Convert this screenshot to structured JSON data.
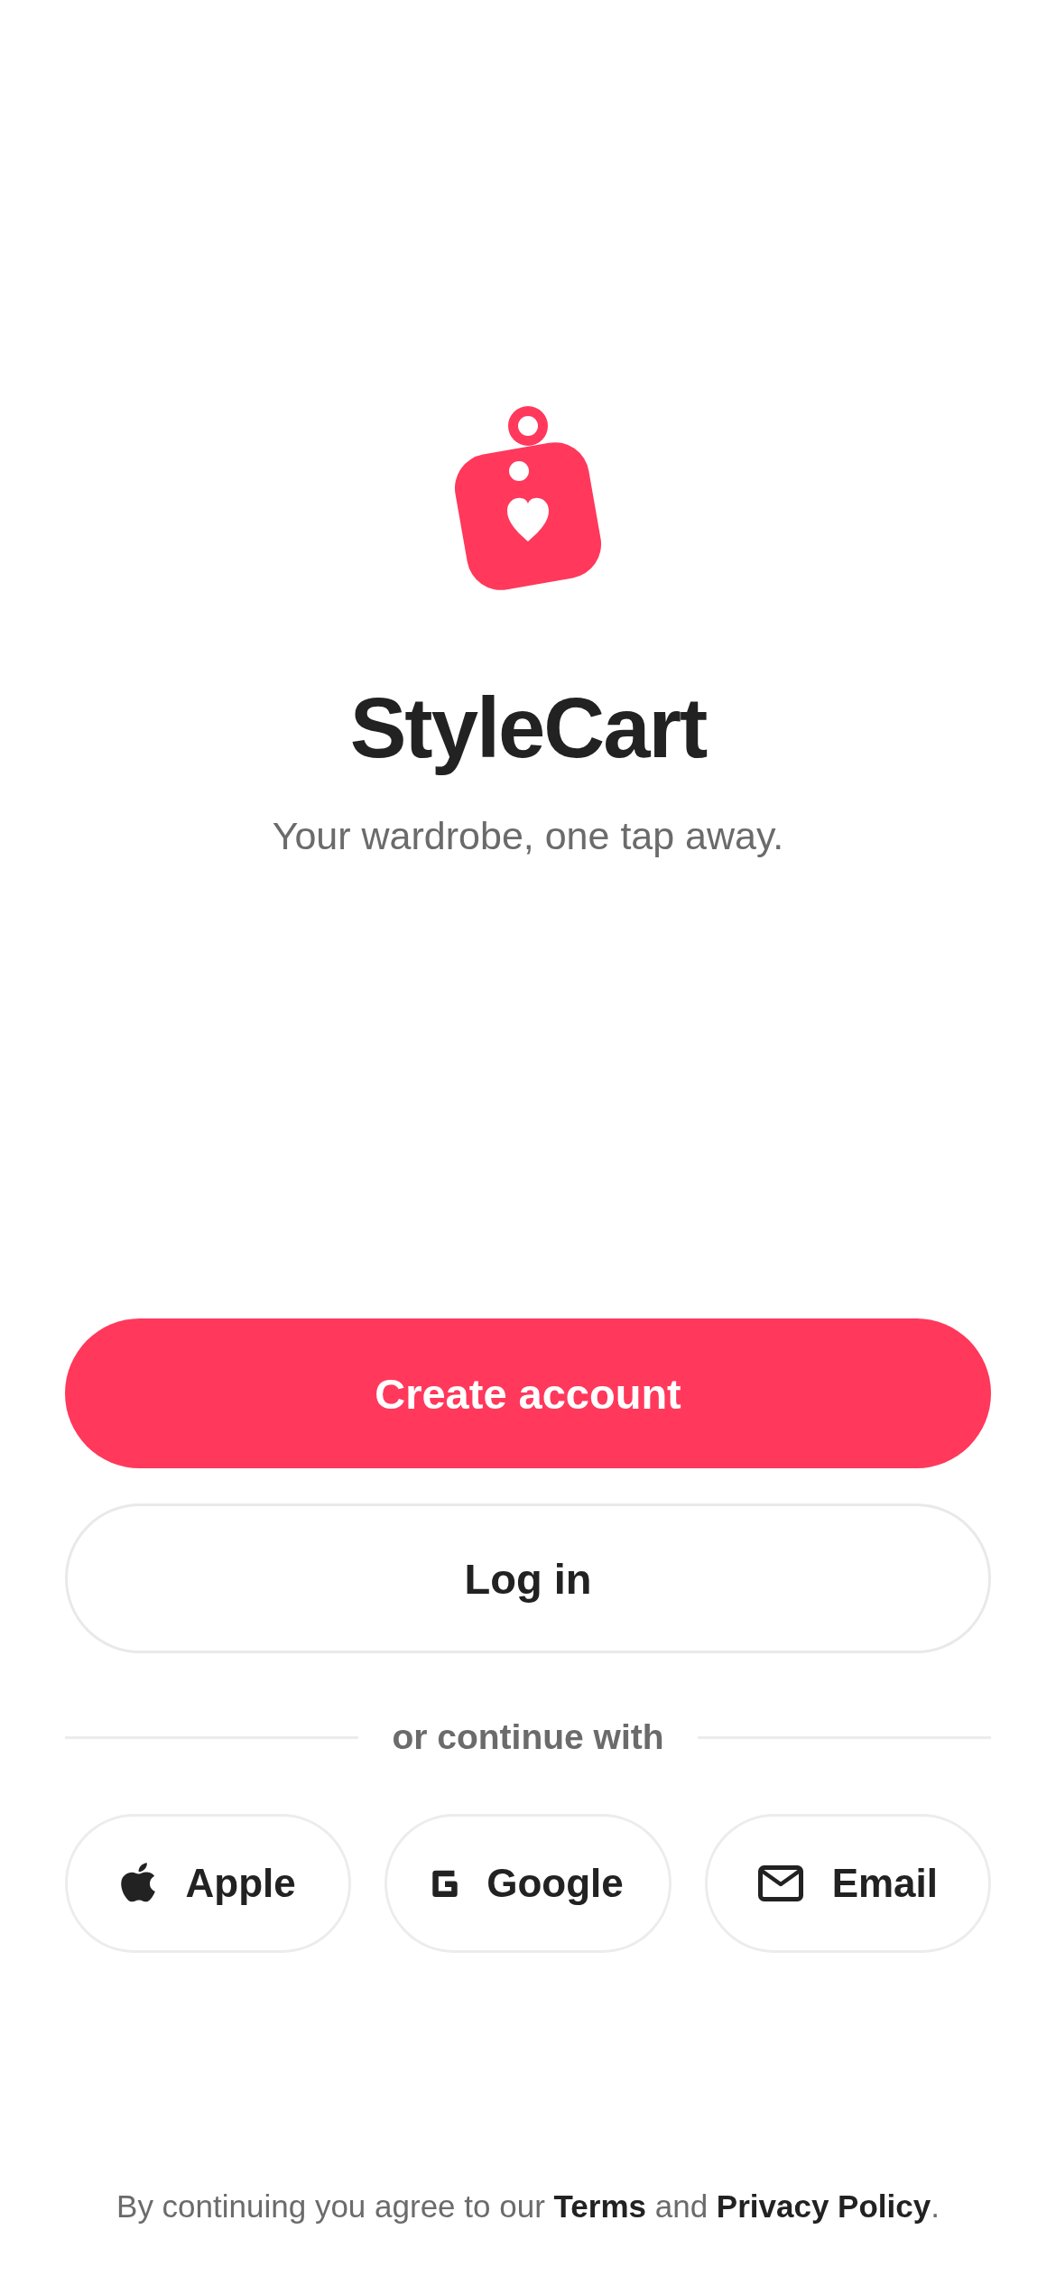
{
  "brand": {
    "name": "StyleCart",
    "tagline": "Your wardrobe, one tap away."
  },
  "actions": [
    {
      "label": "Create account",
      "kind": "primary"
    },
    {
      "label": "Log in",
      "kind": "secondary"
    }
  ],
  "divider": {
    "label": "or continue with"
  },
  "social": [
    {
      "label": "Apple",
      "kind": "apple"
    },
    {
      "label": "Google",
      "kind": "google"
    },
    {
      "label": "Email",
      "kind": "email"
    }
  ],
  "legal": [
    {
      "kind": "text",
      "text": "By continuing you agree to our "
    },
    {
      "kind": "link",
      "text": "Terms"
    },
    {
      "kind": "text",
      "text": " and "
    },
    {
      "kind": "link",
      "text": "Privacy Policy"
    },
    {
      "kind": "text",
      "text": "."
    }
  ]
}
